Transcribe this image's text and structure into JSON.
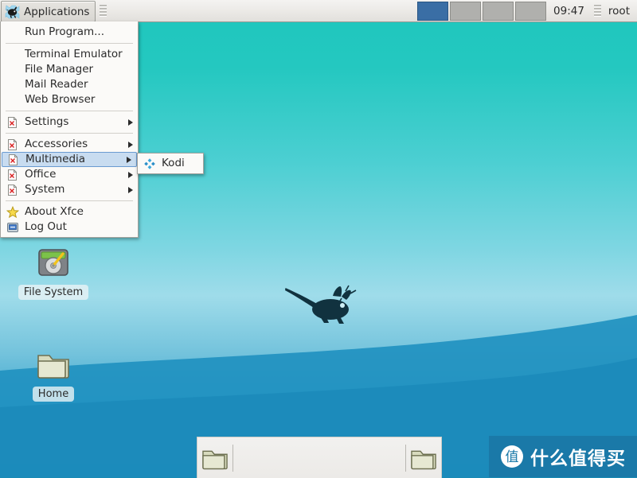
{
  "panel": {
    "applications_label": "Applications",
    "applications_icon": "xfce-mouse-icon",
    "clock": "09:47",
    "user": "root",
    "workspaces": [
      {
        "name": "workspace-1",
        "active": true
      },
      {
        "name": "workspace-2",
        "active": false
      },
      {
        "name": "workspace-3",
        "active": false
      },
      {
        "name": "workspace-4",
        "active": false
      }
    ],
    "active_workspace_color": "#3a6ea5",
    "inactive_workspace_color": "#b0b0ad"
  },
  "menu": {
    "items": [
      {
        "label": "Run Program...",
        "icon": "none",
        "submenu": false,
        "selected": false
      },
      {
        "label": "Terminal Emulator",
        "icon": "none",
        "submenu": false,
        "selected": false
      },
      {
        "label": "File Manager",
        "icon": "none",
        "submenu": false,
        "selected": false
      },
      {
        "label": "Mail Reader",
        "icon": "none",
        "submenu": false,
        "selected": false
      },
      {
        "label": "Web Browser",
        "icon": "none",
        "submenu": false,
        "selected": false
      },
      {
        "label": "Settings",
        "icon": "broken-image-icon",
        "submenu": true,
        "selected": false
      },
      {
        "label": "Accessories",
        "icon": "broken-image-icon",
        "submenu": true,
        "selected": false
      },
      {
        "label": "Multimedia",
        "icon": "broken-image-icon",
        "submenu": true,
        "selected": true
      },
      {
        "label": "Office",
        "icon": "broken-image-icon",
        "submenu": true,
        "selected": false
      },
      {
        "label": "System",
        "icon": "broken-image-icon",
        "submenu": true,
        "selected": false
      },
      {
        "label": "About Xfce",
        "icon": "star-icon",
        "submenu": false,
        "selected": false
      },
      {
        "label": "Log Out",
        "icon": "logout-screen-icon",
        "submenu": false,
        "selected": false
      }
    ],
    "highlight_color": "#c8dcf0",
    "highlight_border": "#6a9bd1"
  },
  "submenu": {
    "parent": "Multimedia",
    "items": [
      {
        "label": "Kodi",
        "icon": "kodi-icon"
      }
    ]
  },
  "desktop": {
    "icons": [
      {
        "label": "File System",
        "icon": "harddisk-icon"
      },
      {
        "label": "Home",
        "icon": "folder-icon"
      }
    ],
    "wallpaper": {
      "name": "xfce-mouse-wallpaper",
      "top_color": "#1ec6bd",
      "mid_color": "#9fdcea",
      "bottom_color": "#1f8ec0",
      "mouse_color": "#11323f"
    }
  },
  "dock": {
    "items": [
      {
        "label": "",
        "icon": "folder-icon"
      },
      {
        "label": "",
        "icon": "folder-icon"
      }
    ]
  },
  "watermark": {
    "badge": "值",
    "text": "什么值得买",
    "background": "#1a79a8"
  }
}
